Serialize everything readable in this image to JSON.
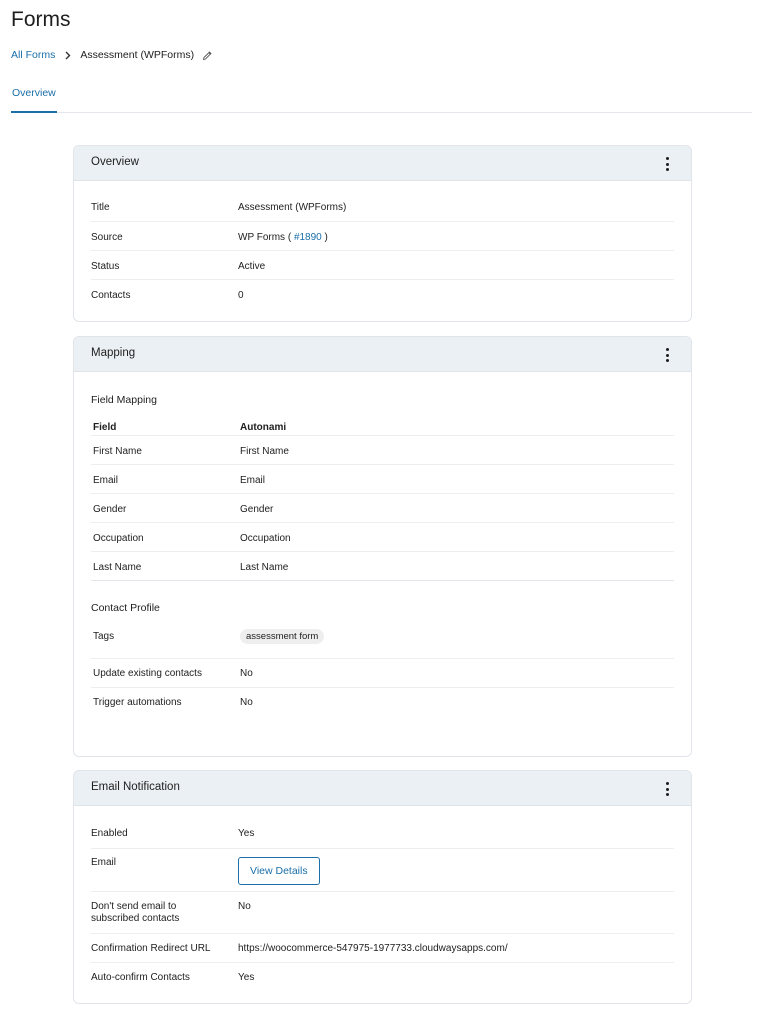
{
  "page": {
    "title": "Forms"
  },
  "breadcrumb": {
    "parent": "All Forms",
    "current": "Assessment (WPForms)"
  },
  "tabs": [
    {
      "label": "Overview",
      "active": true
    }
  ],
  "overview_card": {
    "title": "Overview",
    "rows": {
      "title": {
        "label": "Title",
        "value": "Assessment (WPForms)"
      },
      "source": {
        "label": "Source",
        "prefix": "WP Forms ( ",
        "link": "#1890",
        "suffix": " )"
      },
      "status": {
        "label": "Status",
        "value": "Active"
      },
      "contacts": {
        "label": "Contacts",
        "value": "0"
      }
    }
  },
  "mapping_card": {
    "title": "Mapping",
    "field_mapping_title": "Field Mapping",
    "columns": {
      "field": "Field",
      "autonami": "Autonami"
    },
    "rows": [
      {
        "field": "First Name",
        "autonami": "First Name"
      },
      {
        "field": "Email",
        "autonami": "Email"
      },
      {
        "field": "Gender",
        "autonami": "Gender"
      },
      {
        "field": "Occupation",
        "autonami": "Occupation"
      },
      {
        "field": "Last Name",
        "autonami": "Last Name"
      }
    ],
    "contact_profile_title": "Contact Profile",
    "tags": {
      "label": "Tags",
      "value": "assessment form"
    },
    "update_existing": {
      "label": "Update existing contacts",
      "value": "No"
    },
    "trigger_automations": {
      "label": "Trigger automations",
      "value": "No"
    }
  },
  "email_card": {
    "title": "Email Notification",
    "enabled": {
      "label": "Enabled",
      "value": "Yes"
    },
    "email": {
      "label": "Email",
      "button": "View Details"
    },
    "dont_send": {
      "label_line1": "Don't send email to",
      "label_line2": "subscribed contacts",
      "value": "No"
    },
    "redirect_url": {
      "label": "Confirmation Redirect URL",
      "value": "https://woocommerce-547975-1977733.cloudwaysapps.com/"
    },
    "auto_confirm": {
      "label": "Auto-confirm Contacts",
      "value": "Yes"
    }
  },
  "icons": {
    "breadcrumb_separator": "chevron-right-icon",
    "edit": "pencil-icon",
    "menu": "kebab-menu-icon"
  },
  "colors": {
    "accent": "#1a6fa8",
    "card_header_bg": "#ebf0f4",
    "border": "#e1e5ea"
  }
}
